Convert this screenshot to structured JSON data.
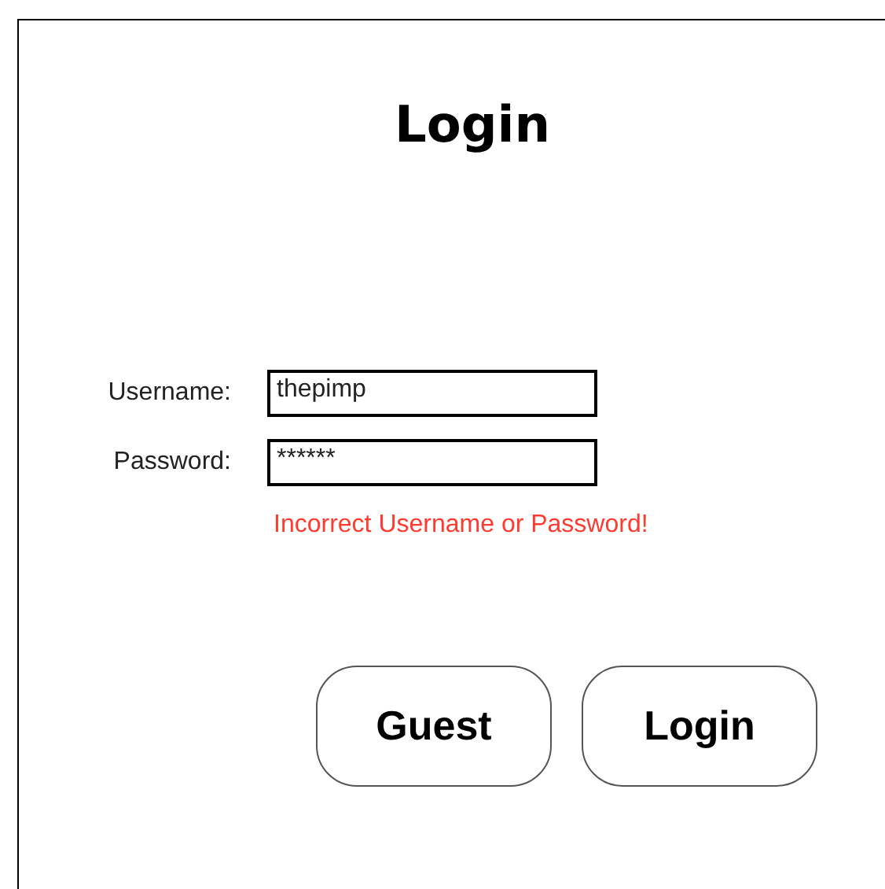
{
  "title": "Login",
  "fields": [
    {
      "label": "Username:",
      "value": "thepimp"
    },
    {
      "label": "Password:",
      "value": "******"
    }
  ],
  "error": "Incorrect Username or Password!",
  "buttons": [
    "Guest",
    "Login"
  ]
}
